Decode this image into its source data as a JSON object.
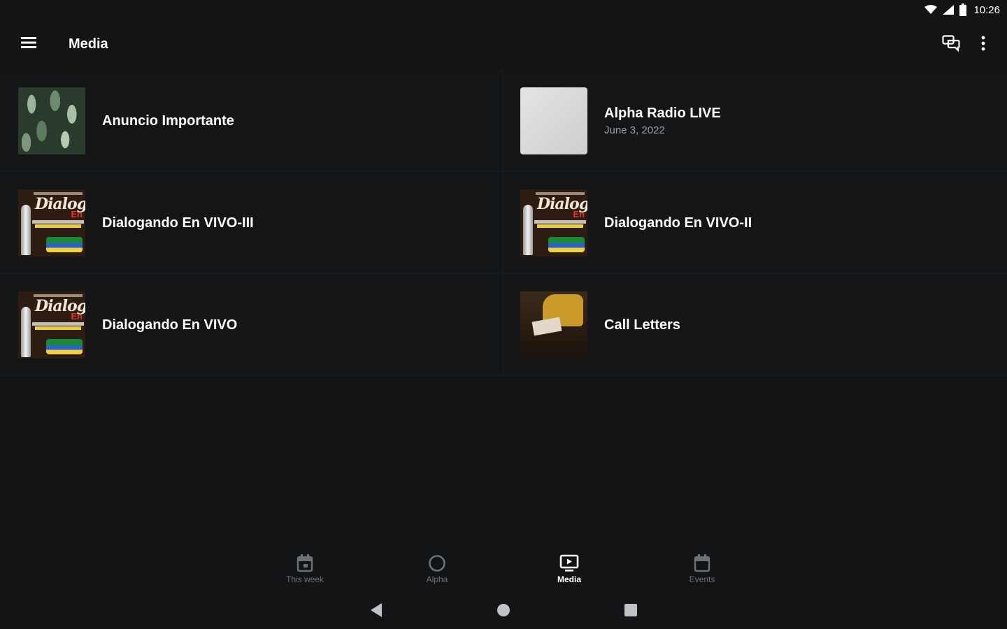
{
  "status_bar": {
    "time": "10:26",
    "icons": [
      "wifi-icon",
      "cell-signal-icon",
      "battery-icon"
    ]
  },
  "app_bar": {
    "title": "Media",
    "left_icon": "menu-icon",
    "right_icons": [
      "chat-icon",
      "more-vert-icon"
    ]
  },
  "media_items": [
    {
      "title": "Anuncio Importante",
      "date": "",
      "thumbnail": "leaves-photo"
    },
    {
      "title": "Alpha Radio LIVE",
      "date": "June 3, 2022",
      "thumbnail": "blank-paper"
    },
    {
      "title": "Dialogando En VIVO-III",
      "date": "",
      "thumbnail": "dialogando-poster"
    },
    {
      "title": "Dialogando En VIVO-II",
      "date": "",
      "thumbnail": "dialogando-poster"
    },
    {
      "title": "Dialogando En VIVO",
      "date": "",
      "thumbnail": "dialogando-poster"
    },
    {
      "title": "Call Letters",
      "date": "",
      "thumbnail": "reading-photo"
    }
  ],
  "poster_text": {
    "script": "Dialogan",
    "en": "En"
  },
  "bottom_nav": {
    "items": [
      {
        "label": "This week",
        "icon": "calendar-week-icon",
        "active": false
      },
      {
        "label": "Alpha",
        "icon": "circle-icon",
        "active": false
      },
      {
        "label": "Media",
        "icon": "tv-play-icon",
        "active": true
      },
      {
        "label": "Events",
        "icon": "calendar-icon",
        "active": false
      }
    ]
  },
  "system_nav": [
    "back-icon",
    "home-icon",
    "recents-icon"
  ],
  "colors": {
    "background": "#121416",
    "text_primary": "#ffffff",
    "text_secondary": "#9aa0a4",
    "nav_inactive": "#6c7175"
  }
}
